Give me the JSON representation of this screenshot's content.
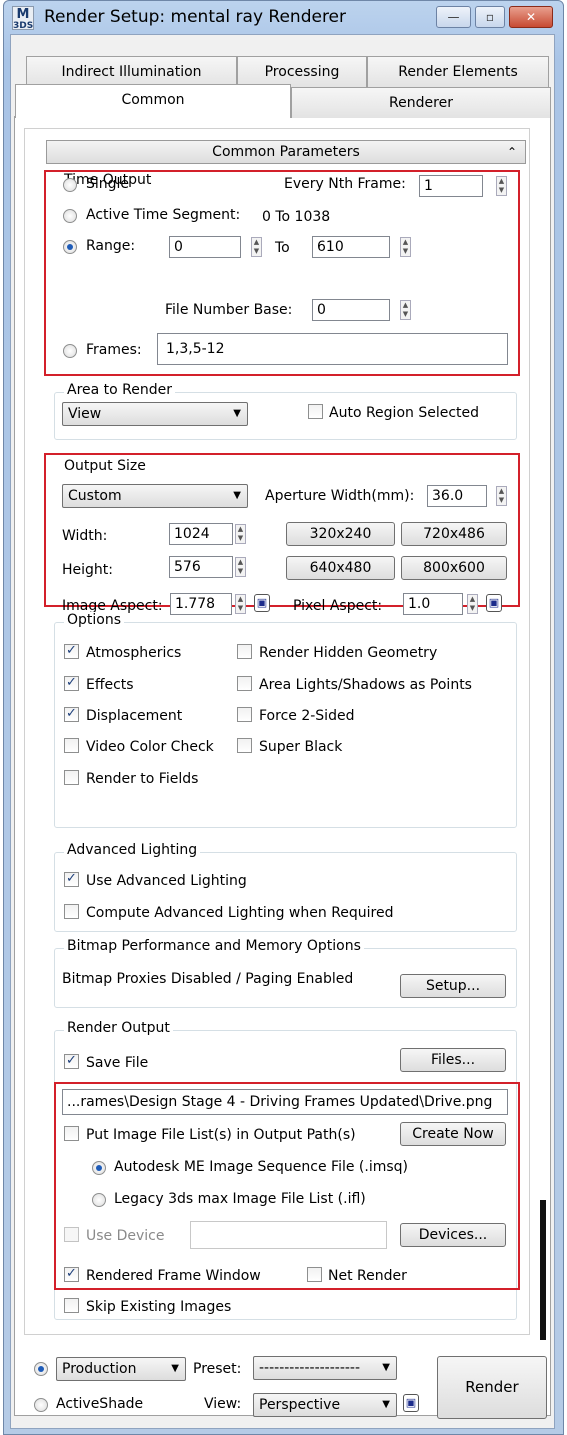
{
  "window": {
    "title": "Render Setup: mental ray Renderer",
    "icon_top": "M",
    "icon_bottom": "3DS",
    "minimize": "—",
    "maximize": "▫",
    "close": "✕"
  },
  "tabs_row1": [
    "Indirect Illumination",
    "Processing",
    "Render Elements"
  ],
  "tabs_row2": [
    "Common",
    "Renderer"
  ],
  "rollout_title": "Common Parameters",
  "rollout_icon": "collapse-icon",
  "time_output": {
    "label": "Time Output",
    "single": "Single",
    "every_nth_label": "Every Nth Frame:",
    "every_nth_value": "1",
    "active_segment": "Active Time Segment:",
    "active_segment_value": "0 To 1038",
    "range": "Range:",
    "range_from": "0",
    "to": "To",
    "range_to": "610",
    "file_base_label": "File Number Base:",
    "file_base_value": "0",
    "frames": "Frames:",
    "frames_value": "1,3,5-12"
  },
  "area_to_render": {
    "label": "Area to Render",
    "selected": "View",
    "auto_region": "Auto Region Selected"
  },
  "output_size": {
    "label": "Output Size",
    "preset": "Custom",
    "aperture_label": "Aperture Width(mm):",
    "aperture_value": "36.0",
    "width_label": "Width:",
    "width_value": "1024",
    "height_label": "Height:",
    "height_value": "576",
    "presets": [
      "320x240",
      "720x486",
      "640x480",
      "800x600"
    ],
    "image_aspect_label": "Image Aspect:",
    "image_aspect_value": "1.778",
    "pixel_aspect_label": "Pixel Aspect:",
    "pixel_aspect_value": "1.0"
  },
  "options": {
    "label": "Options",
    "atmospherics": "Atmospherics",
    "effects": "Effects",
    "displacement": "Displacement",
    "video_color": "Video Color Check",
    "render_fields": "Render to Fields",
    "hidden_geometry": "Render Hidden Geometry",
    "area_lights": "Area Lights/Shadows as Points",
    "force_2sided": "Force 2-Sided",
    "super_black": "Super Black"
  },
  "advanced_lighting": {
    "label": "Advanced Lighting",
    "use": "Use Advanced Lighting",
    "compute": "Compute Advanced Lighting when Required"
  },
  "bitmap": {
    "label": "Bitmap Performance and Memory Options",
    "status": "Bitmap Proxies Disabled / Paging Enabled",
    "setup": "Setup..."
  },
  "render_output": {
    "label": "Render Output",
    "save_file": "Save File",
    "files": "Files...",
    "path": "...rames\\Design Stage 4 - Driving Frames Updated\\Drive.png",
    "put_list": "Put Image File List(s) in Output Path(s)",
    "create_now": "Create Now",
    "imsq": "Autodesk ME Image Sequence File (.imsq)",
    "ifl": "Legacy 3ds max Image File List (.ifl)",
    "use_device": "Use Device",
    "devices": "Devices...",
    "rendered_frame": "Rendered Frame Window",
    "net_render": "Net Render",
    "skip_existing": "Skip Existing Images"
  },
  "footer": {
    "production": "Production",
    "activeshade": "ActiveShade",
    "preset_label": "Preset:",
    "preset_value": "--------------------",
    "view_label": "View:",
    "view_value": "Perspective",
    "render": "Render"
  },
  "colors": {
    "highlight_box": "#d3202a",
    "title_bar": "#bcd3ee"
  }
}
